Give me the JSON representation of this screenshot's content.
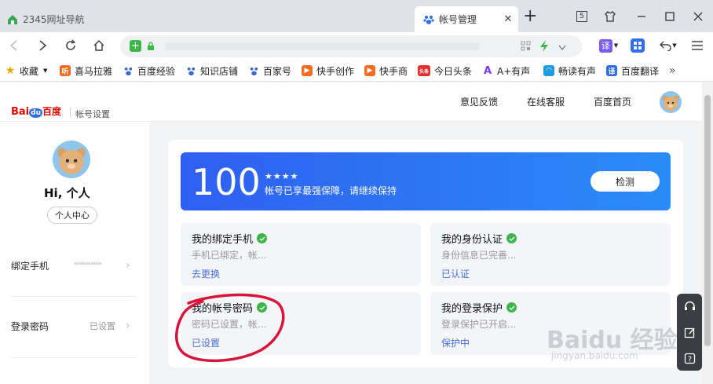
{
  "tabs": [
    {
      "title": "2345网址导航"
    },
    {
      "title": "帐号管理",
      "close": "✕"
    }
  ],
  "new_tab": "+",
  "window": {
    "badge": "5"
  },
  "bookmarks": [
    {
      "label": "收藏",
      "color": "#f0a400"
    },
    {
      "label": "喜马拉雅",
      "color": "#f36b21",
      "glyph": "听"
    },
    {
      "label": "百度经验",
      "color": "#3a66d4"
    },
    {
      "label": "知识店铺",
      "color": "#3a66d4"
    },
    {
      "label": "百家号",
      "color": "#3a66d4"
    },
    {
      "label": "快手创作",
      "color": "#f36b21"
    },
    {
      "label": "快手商",
      "color": "#f36b21"
    },
    {
      "label": "今日头条",
      "color": "#e03030",
      "glyph": "头条"
    },
    {
      "label": "A+有声",
      "color": "#7c3aed"
    },
    {
      "label": "畅读有声",
      "color": "#1e9be0"
    },
    {
      "label": "百度翻译",
      "color": "#2f6ee0",
      "glyph": "译"
    }
  ],
  "bookmarks_more": "»",
  "translate_label": "译",
  "page": {
    "logo": {
      "bai": "Bai",
      "du": "du",
      "baidu_cn": "百度"
    },
    "account_settings": "帐号设置",
    "header_links": [
      "意见反馈",
      "在线客服",
      "百度首页"
    ]
  },
  "sidebar": {
    "greeting": "Hi, 个人",
    "center_button": "个人中心",
    "rows": [
      {
        "label": "绑定手机",
        "value": "**********"
      },
      {
        "label": "登录密码",
        "value": "已设置"
      }
    ]
  },
  "security": {
    "score": "100",
    "stars": "★★★★",
    "message": "帐号已享最强保障，请继续保持",
    "check_button": "检测"
  },
  "items": [
    {
      "title": "我的绑定手机",
      "desc": "手机已绑定，帐...",
      "link": "去更换"
    },
    {
      "title": "我的身份认证",
      "desc": "身份信息已完善...",
      "link": "已认证"
    },
    {
      "title": "我的帐号密码",
      "desc": "密码已设置，帐...",
      "link": "已设置"
    },
    {
      "title": "我的登录保护",
      "desc": "登录保护已开启...",
      "link": "保护中"
    }
  ],
  "watermark": {
    "main": "Baidu 经验",
    "sub": "jingyan.baidu.com"
  },
  "colors": {
    "accent": "#2f6ef0",
    "check": "#3cb64a",
    "annotation": "#d7153a"
  }
}
